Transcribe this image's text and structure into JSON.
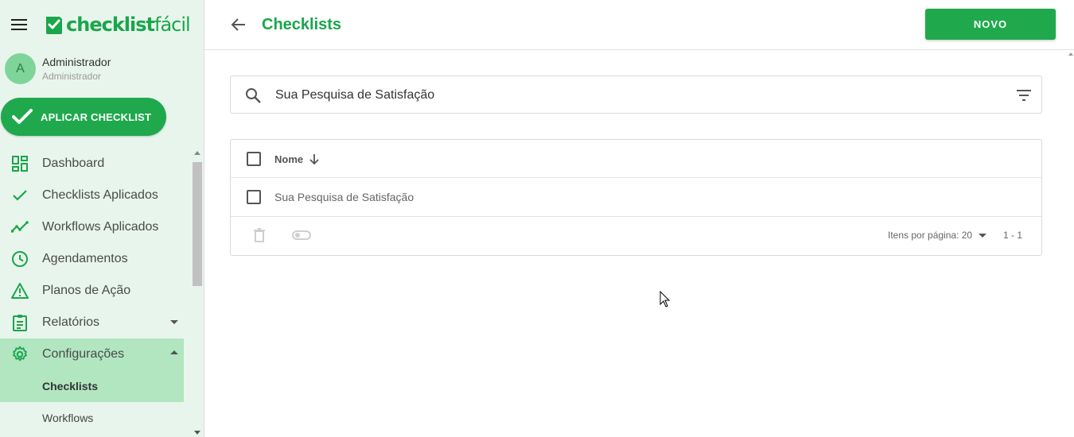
{
  "brand": {
    "logo_bold": "checklist",
    "logo_light": "fácil",
    "color": "#1aa64a"
  },
  "user": {
    "initial": "A",
    "name": "Administrador",
    "role": "Administrador"
  },
  "apply_button": {
    "label": "APLICAR CHECKLIST"
  },
  "nav": {
    "items": [
      {
        "label": "Dashboard",
        "icon": "dashboard-icon"
      },
      {
        "label": "Checklists Aplicados",
        "icon": "check-icon"
      },
      {
        "label": "Workflows Aplicados",
        "icon": "trending-up-icon"
      },
      {
        "label": "Agendamentos",
        "icon": "clock-icon"
      },
      {
        "label": "Planos de Ação",
        "icon": "warning-icon"
      },
      {
        "label": "Relatórios",
        "icon": "clipboard-icon"
      },
      {
        "label": "Configurações",
        "icon": "gear-icon"
      }
    ],
    "sub_items": [
      {
        "label": "Checklists"
      },
      {
        "label": "Workflows"
      }
    ]
  },
  "header": {
    "title": "Checklists",
    "new_button": "NOVO"
  },
  "search": {
    "value": "Sua Pesquisa de Satisfação",
    "placeholder": ""
  },
  "table": {
    "columns": [
      {
        "label": "Nome",
        "sort": "descending"
      }
    ],
    "rows": [
      {
        "name": "Sua Pesquisa de Satisfação"
      }
    ],
    "footer": {
      "per_page_label": "Itens por página: 20",
      "range": "1 - 1"
    }
  }
}
